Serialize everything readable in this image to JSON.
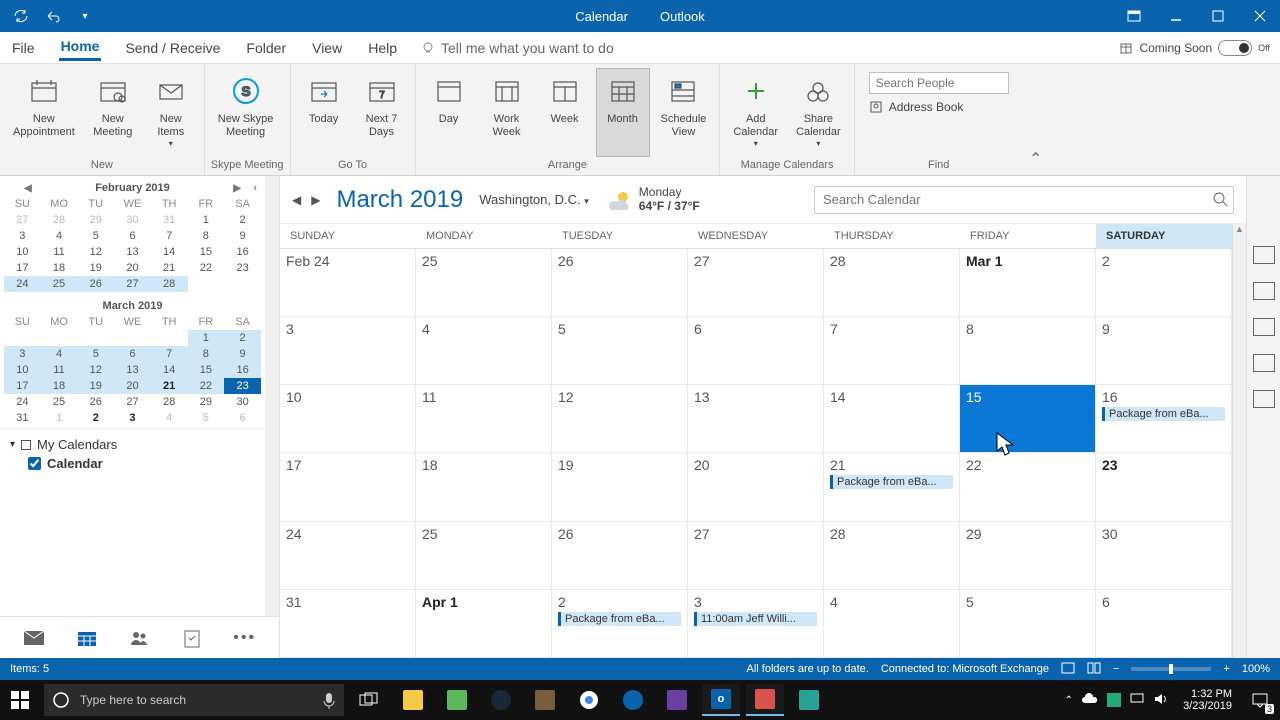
{
  "titlebar": {
    "center_app": "Calendar",
    "center_suite": "Outlook"
  },
  "tabs": [
    "File",
    "Home",
    "Send / Receive",
    "Folder",
    "View",
    "Help"
  ],
  "tellme": "Tell me what you want to do",
  "coming_soon": {
    "label": "Coming Soon",
    "state": "Off"
  },
  "ribbon": {
    "new_group": "New",
    "new_appointment": "New\nAppointment",
    "new_meeting": "New\nMeeting",
    "new_items": "New\nItems",
    "skype_group": "Skype Meeting",
    "skype": "New Skype\nMeeting",
    "goto_group": "Go To",
    "today": "Today",
    "next7": "Next 7\nDays",
    "arrange_group": "Arrange",
    "day": "Day",
    "workweek": "Work\nWeek",
    "week": "Week",
    "month": "Month",
    "schedule": "Schedule\nView",
    "manage_group": "Manage Calendars",
    "add_cal": "Add\nCalendar",
    "share_cal": "Share\nCalendar",
    "find_group": "Find",
    "search_people": "Search People",
    "address_book": "Address Book"
  },
  "minicals": {
    "feb": {
      "title": "February 2019",
      "dow": [
        "SU",
        "MO",
        "TU",
        "WE",
        "TH",
        "FR",
        "SA"
      ],
      "rows": [
        [
          {
            "d": "27",
            "o": 1
          },
          {
            "d": "28",
            "o": 1
          },
          {
            "d": "29",
            "o": 1
          },
          {
            "d": "30",
            "o": 1
          },
          {
            "d": "31",
            "o": 1
          },
          {
            "d": "1"
          },
          {
            "d": "2"
          }
        ],
        [
          {
            "d": "3"
          },
          {
            "d": "4"
          },
          {
            "d": "5"
          },
          {
            "d": "6"
          },
          {
            "d": "7"
          },
          {
            "d": "8"
          },
          {
            "d": "9"
          }
        ],
        [
          {
            "d": "10"
          },
          {
            "d": "11"
          },
          {
            "d": "12"
          },
          {
            "d": "13"
          },
          {
            "d": "14"
          },
          {
            "d": "15"
          },
          {
            "d": "16"
          }
        ],
        [
          {
            "d": "17"
          },
          {
            "d": "18"
          },
          {
            "d": "19"
          },
          {
            "d": "20"
          },
          {
            "d": "21"
          },
          {
            "d": "22"
          },
          {
            "d": "23"
          }
        ],
        [
          {
            "d": "24",
            "hl": 1
          },
          {
            "d": "25",
            "hl": 1
          },
          {
            "d": "26",
            "hl": 1
          },
          {
            "d": "27",
            "hl": 1
          },
          {
            "d": "28",
            "hl": 1
          },
          {
            "d": ""
          },
          {
            "d": ""
          }
        ]
      ]
    },
    "mar": {
      "title": "March 2019",
      "dow": [
        "SU",
        "MO",
        "TU",
        "WE",
        "TH",
        "FR",
        "SA"
      ],
      "rows": [
        [
          {
            "d": ""
          },
          {
            "d": ""
          },
          {
            "d": ""
          },
          {
            "d": ""
          },
          {
            "d": ""
          },
          {
            "d": "1",
            "hl": 1
          },
          {
            "d": "2",
            "hl": 1
          }
        ],
        [
          {
            "d": "3",
            "hl": 1
          },
          {
            "d": "4",
            "hl": 1
          },
          {
            "d": "5",
            "hl": 1
          },
          {
            "d": "6",
            "hl": 1
          },
          {
            "d": "7",
            "hl": 1
          },
          {
            "d": "8",
            "hl": 1
          },
          {
            "d": "9",
            "hl": 1
          }
        ],
        [
          {
            "d": "10",
            "hl": 1
          },
          {
            "d": "11",
            "hl": 1
          },
          {
            "d": "12",
            "hl": 1
          },
          {
            "d": "13",
            "hl": 1
          },
          {
            "d": "14",
            "hl": 1
          },
          {
            "d": "15",
            "hl": 1
          },
          {
            "d": "16",
            "hl": 1
          }
        ],
        [
          {
            "d": "17",
            "hl": 1
          },
          {
            "d": "18",
            "hl": 1
          },
          {
            "d": "19",
            "hl": 1
          },
          {
            "d": "20",
            "hl": 1
          },
          {
            "d": "21",
            "hl": 1,
            "b": 1
          },
          {
            "d": "22",
            "hl": 1
          },
          {
            "d": "23",
            "today": 1
          }
        ],
        [
          {
            "d": "24"
          },
          {
            "d": "25"
          },
          {
            "d": "26"
          },
          {
            "d": "27"
          },
          {
            "d": "28"
          },
          {
            "d": "29"
          },
          {
            "d": "30"
          }
        ],
        [
          {
            "d": "31"
          },
          {
            "d": "1",
            "o": 1
          },
          {
            "d": "2",
            "o": 1,
            "b": 1
          },
          {
            "d": "3",
            "o": 1,
            "b": 1
          },
          {
            "d": "4",
            "o": 1
          },
          {
            "d": "5",
            "o": 1
          },
          {
            "d": "6",
            "o": 1
          }
        ]
      ]
    }
  },
  "mycalendars": {
    "header": "My Calendars",
    "item": "Calendar"
  },
  "calhead": {
    "month": "March 2019",
    "location": "Washington,  D.C.",
    "weather_day": "Monday",
    "weather_temp": "64°F / 37°F",
    "search_placeholder": "Search Calendar"
  },
  "dayheaders": [
    "SUNDAY",
    "MONDAY",
    "TUESDAY",
    "WEDNESDAY",
    "THURSDAY",
    "FRIDAY",
    "SATURDAY"
  ],
  "cells": [
    {
      "dn": "Feb 24"
    },
    {
      "dn": "25"
    },
    {
      "dn": "26"
    },
    {
      "dn": "27"
    },
    {
      "dn": "28"
    },
    {
      "dn": "Mar 1",
      "bold": 1
    },
    {
      "dn": "2"
    },
    {
      "dn": "3"
    },
    {
      "dn": "4"
    },
    {
      "dn": "5"
    },
    {
      "dn": "6"
    },
    {
      "dn": "7"
    },
    {
      "dn": "8"
    },
    {
      "dn": "9"
    },
    {
      "dn": "10"
    },
    {
      "dn": "11"
    },
    {
      "dn": "12"
    },
    {
      "dn": "13"
    },
    {
      "dn": "14"
    },
    {
      "dn": "15",
      "selected": 1
    },
    {
      "dn": "16",
      "events": [
        "Package from eBa..."
      ]
    },
    {
      "dn": "17"
    },
    {
      "dn": "18"
    },
    {
      "dn": "19"
    },
    {
      "dn": "20"
    },
    {
      "dn": "21",
      "events": [
        "Package from eBa..."
      ]
    },
    {
      "dn": "22"
    },
    {
      "dn": "23",
      "today": 1,
      "bold": 1
    },
    {
      "dn": "24"
    },
    {
      "dn": "25"
    },
    {
      "dn": "26"
    },
    {
      "dn": "27"
    },
    {
      "dn": "28"
    },
    {
      "dn": "29"
    },
    {
      "dn": "30"
    },
    {
      "dn": "31"
    },
    {
      "dn": "Apr 1",
      "bold": 1
    },
    {
      "dn": "2",
      "events": [
        "Package from eBa..."
      ]
    },
    {
      "dn": "3",
      "events": [
        "11:00am Jeff Willi..."
      ]
    },
    {
      "dn": "4"
    },
    {
      "dn": "5"
    },
    {
      "dn": "6"
    }
  ],
  "statusbar": {
    "items": "Items: 5",
    "folders": "All folders are up to date.",
    "connected": "Connected to: Microsoft Exchange",
    "zoom": "100%"
  },
  "taskbar": {
    "search_placeholder": "Type here to search",
    "time": "1:32 PM",
    "date": "3/23/2019",
    "notif": "3"
  }
}
